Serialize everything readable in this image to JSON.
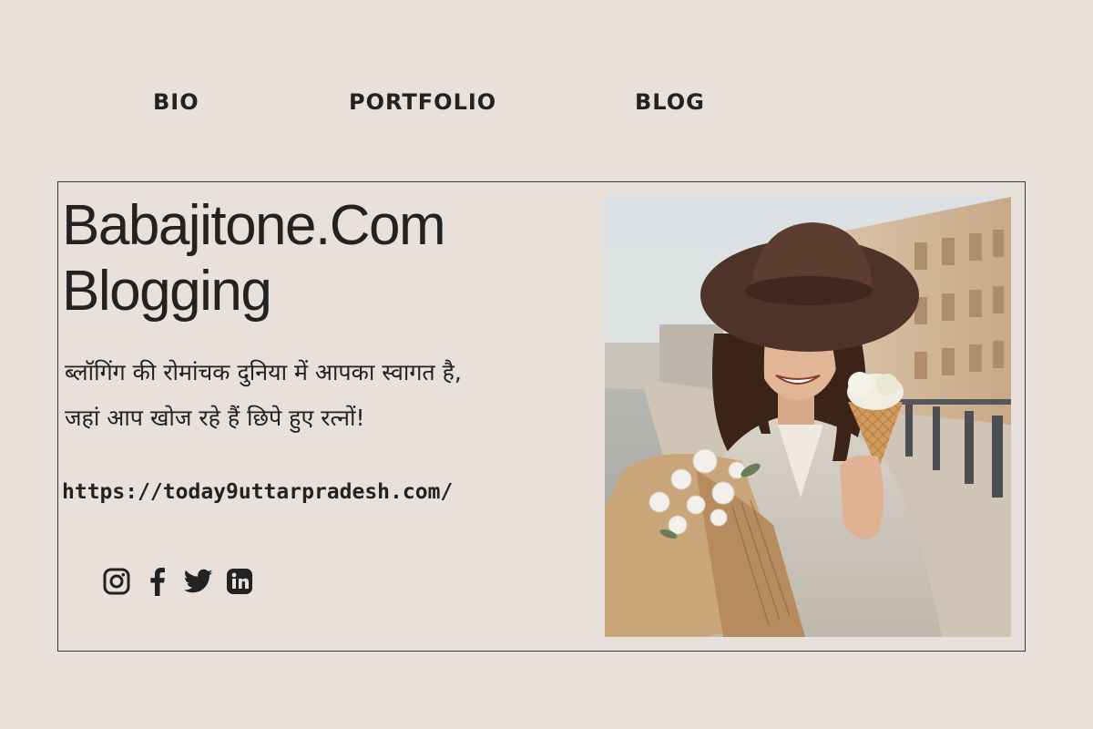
{
  "nav": {
    "bio": "BIO",
    "portfolio": "PORTFOLIO",
    "blog": "BLOG"
  },
  "hero": {
    "title_line1": "Babajitone.Com",
    "title_line2": "Blogging",
    "tagline_line1": "ब्लॉगिंग की रोमांचक दुनिया में आपका स्वागत है,",
    "tagline_line2": "जहां आप खोज रहे हैं छिपे हुए रत्नों!",
    "url": "https://today9uttarpradesh.com/"
  },
  "socials": [
    "instagram-icon",
    "facebook-icon",
    "twitter-icon",
    "linkedin-icon"
  ],
  "colors": {
    "background": "#e8e0db",
    "text": "#222222",
    "border": "#3a3a3a"
  }
}
